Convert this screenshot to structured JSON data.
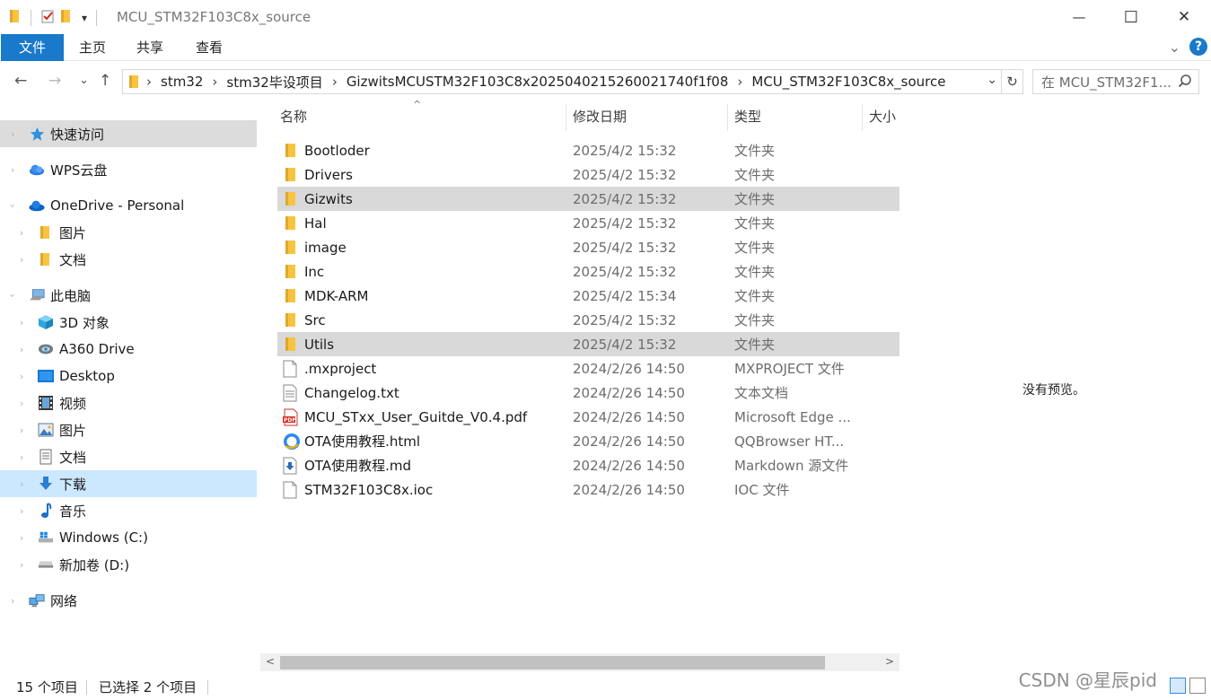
{
  "window": {
    "title": "MCU_STM32F103C8x_source",
    "qat_dropdown": "▾",
    "controls": {
      "minimize": "—",
      "maximize": "☐",
      "close": "✕"
    }
  },
  "ribbon": {
    "tabs": [
      "文件",
      "主页",
      "共享",
      "查看"
    ],
    "expand": "⌄",
    "help": "?"
  },
  "nav": {
    "back": "←",
    "forward": "→",
    "recent": "⌄",
    "up": "↑",
    "breadcrumbs": [
      "stm32",
      "stm32毕设项目",
      "GizwitsMCUSTM32F103C8x2025040215260021740f1f08",
      "MCU_STM32F103C8x_source"
    ],
    "crumb_sep": "›",
    "address_dropdown": "⌄",
    "refresh": "↻",
    "search_placeholder": "在 MCU_STM32F1...",
    "search_icon": "⚲"
  },
  "sidebar": {
    "items": [
      {
        "label": "快速访问",
        "icon": "star-icon"
      },
      {
        "label": "WPS云盘",
        "icon": "cloud-icon"
      },
      {
        "label": "OneDrive - Personal",
        "icon": "onedrive-icon"
      },
      {
        "label": "图片",
        "icon": "folder-icon"
      },
      {
        "label": "文档",
        "icon": "folder-icon"
      },
      {
        "label": "此电脑",
        "icon": "pc-icon"
      },
      {
        "label": "3D 对象",
        "icon": "cube-icon"
      },
      {
        "label": "A360 Drive",
        "icon": "a360-icon"
      },
      {
        "label": "Desktop",
        "icon": "desktop-icon"
      },
      {
        "label": "视频",
        "icon": "video-icon"
      },
      {
        "label": "图片",
        "icon": "pictures-icon"
      },
      {
        "label": "文档",
        "icon": "documents-icon"
      },
      {
        "label": "下载",
        "icon": "download-icon"
      },
      {
        "label": "音乐",
        "icon": "music-icon"
      },
      {
        "label": "Windows (C:)",
        "icon": "drive-c-icon"
      },
      {
        "label": "新加卷 (D:)",
        "icon": "drive-d-icon"
      },
      {
        "label": "网络",
        "icon": "network-icon"
      }
    ],
    "expander": "›"
  },
  "list": {
    "columns": [
      "名称",
      "修改日期",
      "类型",
      "大小"
    ],
    "sort_indicator": "^",
    "rows": [
      {
        "name": "Bootloder",
        "date": "2025/4/2 15:32",
        "type": "文件夹",
        "icon": "folder-icon"
      },
      {
        "name": "Drivers",
        "date": "2025/4/2 15:32",
        "type": "文件夹",
        "icon": "folder-icon"
      },
      {
        "name": "Gizwits",
        "date": "2025/4/2 15:32",
        "type": "文件夹",
        "icon": "folder-icon"
      },
      {
        "name": "Hal",
        "date": "2025/4/2 15:32",
        "type": "文件夹",
        "icon": "folder-icon"
      },
      {
        "name": "image",
        "date": "2025/4/2 15:32",
        "type": "文件夹",
        "icon": "folder-icon"
      },
      {
        "name": "Inc",
        "date": "2025/4/2 15:32",
        "type": "文件夹",
        "icon": "folder-icon"
      },
      {
        "name": "MDK-ARM",
        "date": "2025/4/2 15:34",
        "type": "文件夹",
        "icon": "folder-icon"
      },
      {
        "name": "Src",
        "date": "2025/4/2 15:32",
        "type": "文件夹",
        "icon": "folder-icon"
      },
      {
        "name": "Utils",
        "date": "2025/4/2 15:32",
        "type": "文件夹",
        "icon": "folder-icon"
      },
      {
        "name": ".mxproject",
        "date": "2024/2/26 14:50",
        "type": "MXPROJECT 文件",
        "icon": "file-icon"
      },
      {
        "name": "Changelog.txt",
        "date": "2024/2/26 14:50",
        "type": "文本文档",
        "icon": "text-file-icon"
      },
      {
        "name": "MCU_STxx_User_Guitde_V0.4.pdf",
        "date": "2024/2/26 14:50",
        "type": "Microsoft Edge ...",
        "icon": "pdf-icon"
      },
      {
        "name": "OTA使用教程.html",
        "date": "2024/2/26 14:50",
        "type": "QQBrowser HT...",
        "icon": "browser-icon"
      },
      {
        "name": "OTA使用教程.md",
        "date": "2024/2/26 14:50",
        "type": "Markdown 源文件",
        "icon": "markdown-icon"
      },
      {
        "name": "STM32F103C8x.ioc",
        "date": "2024/2/26 14:50",
        "type": "IOC 文件",
        "icon": "file-icon"
      }
    ],
    "scroll_left": "<",
    "scroll_right": ">"
  },
  "preview": {
    "text": "没有预览。"
  },
  "status": {
    "count": "15 个项目",
    "selection": "已选择 2 个项目"
  },
  "watermark": "CSDN @星辰pid",
  "colors": {
    "accent": "#1979ca",
    "selection": "#d9d9d9",
    "nav_selected": "#cce8ff",
    "folder": "#f8c440"
  }
}
